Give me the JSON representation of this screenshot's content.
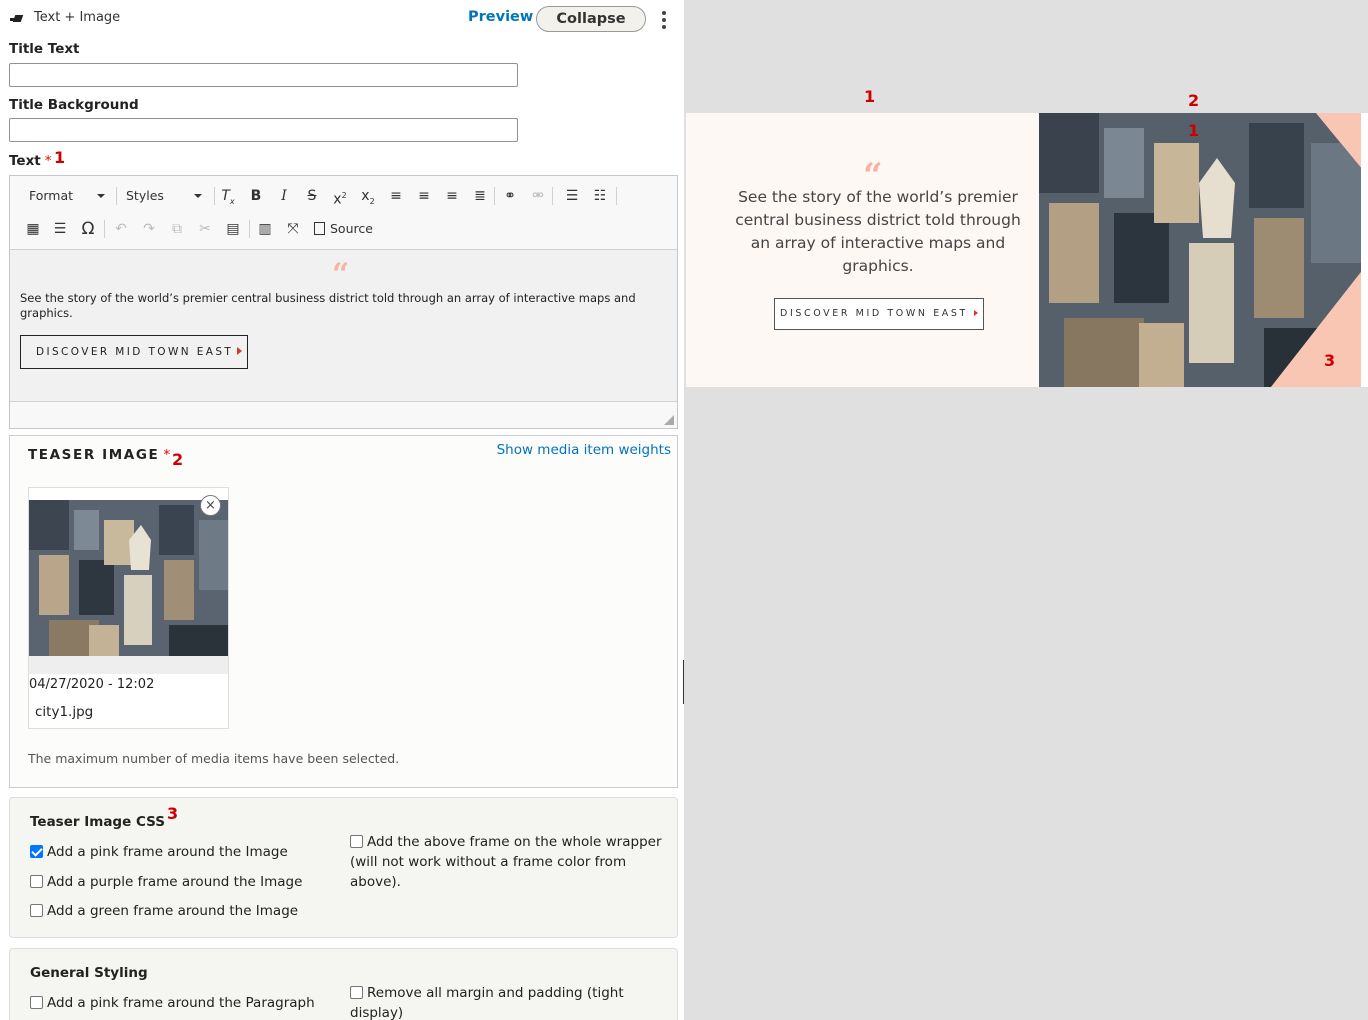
{
  "paragraph": {
    "type_label": "Text + Image",
    "preview_label": "Preview",
    "collapse_label": "Collapse"
  },
  "fields": {
    "title_text": {
      "label": "Title Text",
      "value": ""
    },
    "title_background": {
      "label": "Title Background",
      "value": ""
    },
    "text": {
      "label": "Text",
      "required_mark": "*",
      "marker": "1"
    }
  },
  "editor": {
    "format_label": "Format",
    "styles_label": "Styles",
    "source_label": "Source",
    "content": {
      "quote_glyph": "“",
      "body": "See the story of the world’s premier central business district told through an array of interactive maps and graphics.",
      "button": "DISCOVER MID TOWN EAST"
    }
  },
  "teaser_image": {
    "label": "TEASER IMAGE",
    "required_mark": "*",
    "marker": "2",
    "show_weights": "Show media item weights",
    "media": {
      "date": "04/27/2020 - 12:02",
      "filename": "city1.jpg",
      "remove_glyph": "×"
    },
    "max_message": "The maximum number of media items have been selected."
  },
  "teaser_css": {
    "title": "Teaser Image CSS",
    "marker": "3",
    "options": [
      {
        "label": "Add a pink frame around the Image",
        "checked": true
      },
      {
        "label": "Add a purple frame around the Image",
        "checked": false
      },
      {
        "label": "Add a green frame around the Image",
        "checked": false
      },
      {
        "label": "Add the above frame on the whole wrapper (will not work without a frame color from above).",
        "checked": false
      }
    ]
  },
  "general_styling": {
    "title": "General Styling",
    "options": [
      {
        "label": "Add a pink frame around the Paragraph",
        "checked": false
      },
      {
        "label": "Remove all margin and padding (tight display)",
        "checked": false
      }
    ]
  },
  "preview": {
    "markers": [
      "1",
      "2",
      "1",
      "3"
    ],
    "quote_glyph": "“",
    "body": "See the story of the world’s premier central business district told through an array of interactive maps and graphics.",
    "button": "DISCOVER MID TOWN EAST"
  },
  "colors": {
    "link": "#0074bd",
    "marker": "#cc0000",
    "quote": "#f7b2a3",
    "pink_frame": "#fac6b4",
    "checkbox_checked": "#0075ff"
  }
}
